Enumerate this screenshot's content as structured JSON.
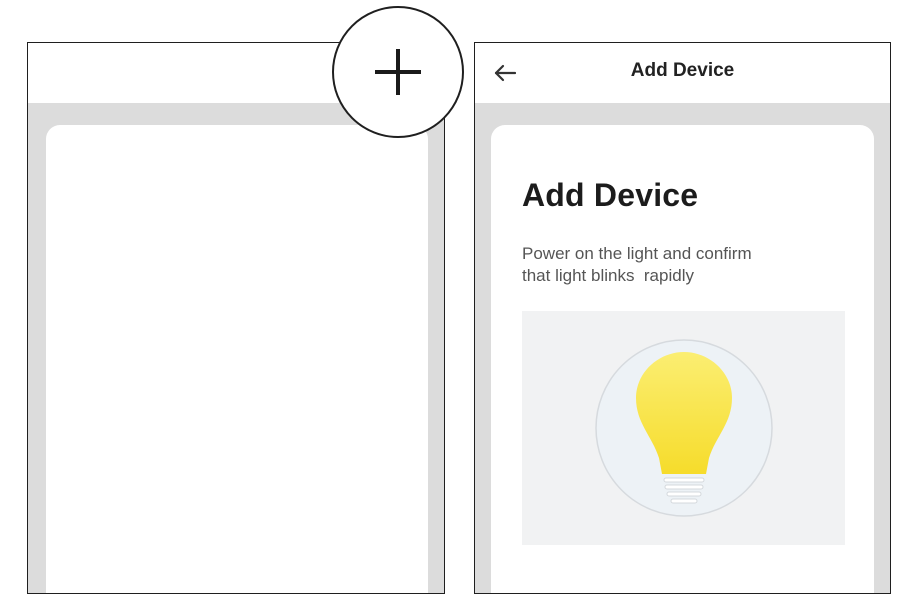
{
  "left_screen": {},
  "right_screen": {
    "topbar": {
      "title": "Add Device"
    },
    "card": {
      "title": "Add Device",
      "description_line1": "Power on the light and confirm",
      "description_line2": "that light blinks  rapidly"
    }
  },
  "callout": {
    "icon": "plus-icon"
  },
  "icons": {
    "back": "arrow-left-icon",
    "bulb": "light-bulb-icon"
  },
  "colors": {
    "bulb_yellow": "#f8e03a",
    "card_bg": "#ffffff",
    "app_bg": "#dcdcdc"
  }
}
